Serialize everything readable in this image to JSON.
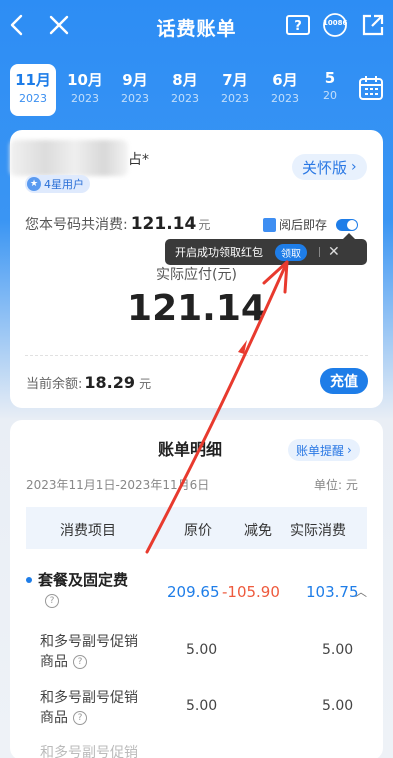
{
  "header": {
    "title": "话费账单",
    "service_badge": "10086"
  },
  "months": [
    {
      "month": "11月",
      "year": "2023",
      "active": true
    },
    {
      "month": "10月",
      "year": "2023"
    },
    {
      "month": "9月",
      "year": "2023"
    },
    {
      "month": "8月",
      "year": "2023"
    },
    {
      "month": "7月",
      "year": "2023"
    },
    {
      "month": "6月",
      "year": "2023"
    },
    {
      "month": "5",
      "year": "20"
    }
  ],
  "user": {
    "name_suffix": "占*",
    "level": "4星用户",
    "care_label": "关怀版"
  },
  "summary": {
    "total_label": "您本号码共消费:",
    "total_value": "121.14",
    "unit": "元",
    "save_label": "阅后即存",
    "tooltip_text": "开启成功领取红包",
    "tooltip_button": "领取",
    "payable_label": "实际应付(元)",
    "payable_value": "121.14",
    "balance_label": "当前余额:",
    "balance_value": "18.29",
    "topup_label": "充值"
  },
  "detail": {
    "title": "账单明细",
    "remind_label": "账单提醒",
    "period": "2023年11月1日-2023年11月6日",
    "unit_label": "单位: 元",
    "columns": [
      "消费项目",
      "原价",
      "减免",
      "实际消费"
    ],
    "package": {
      "name": "套餐及固定费",
      "original": "209.65",
      "discount": "-105.90",
      "actual": "103.75"
    },
    "rows": [
      {
        "line1": "和多号副号促销",
        "line2": "商品",
        "original": "5.00",
        "actual": "5.00"
      },
      {
        "line1": "和多号副号促销",
        "line2": "商品",
        "original": "5.00",
        "actual": "5.00"
      }
    ],
    "partial_row": "和多号副号促销"
  },
  "colors": {
    "brand_blue": "#1e7de8",
    "discount_red": "#ee5a3d",
    "annotation_red": "#e83a2e"
  }
}
